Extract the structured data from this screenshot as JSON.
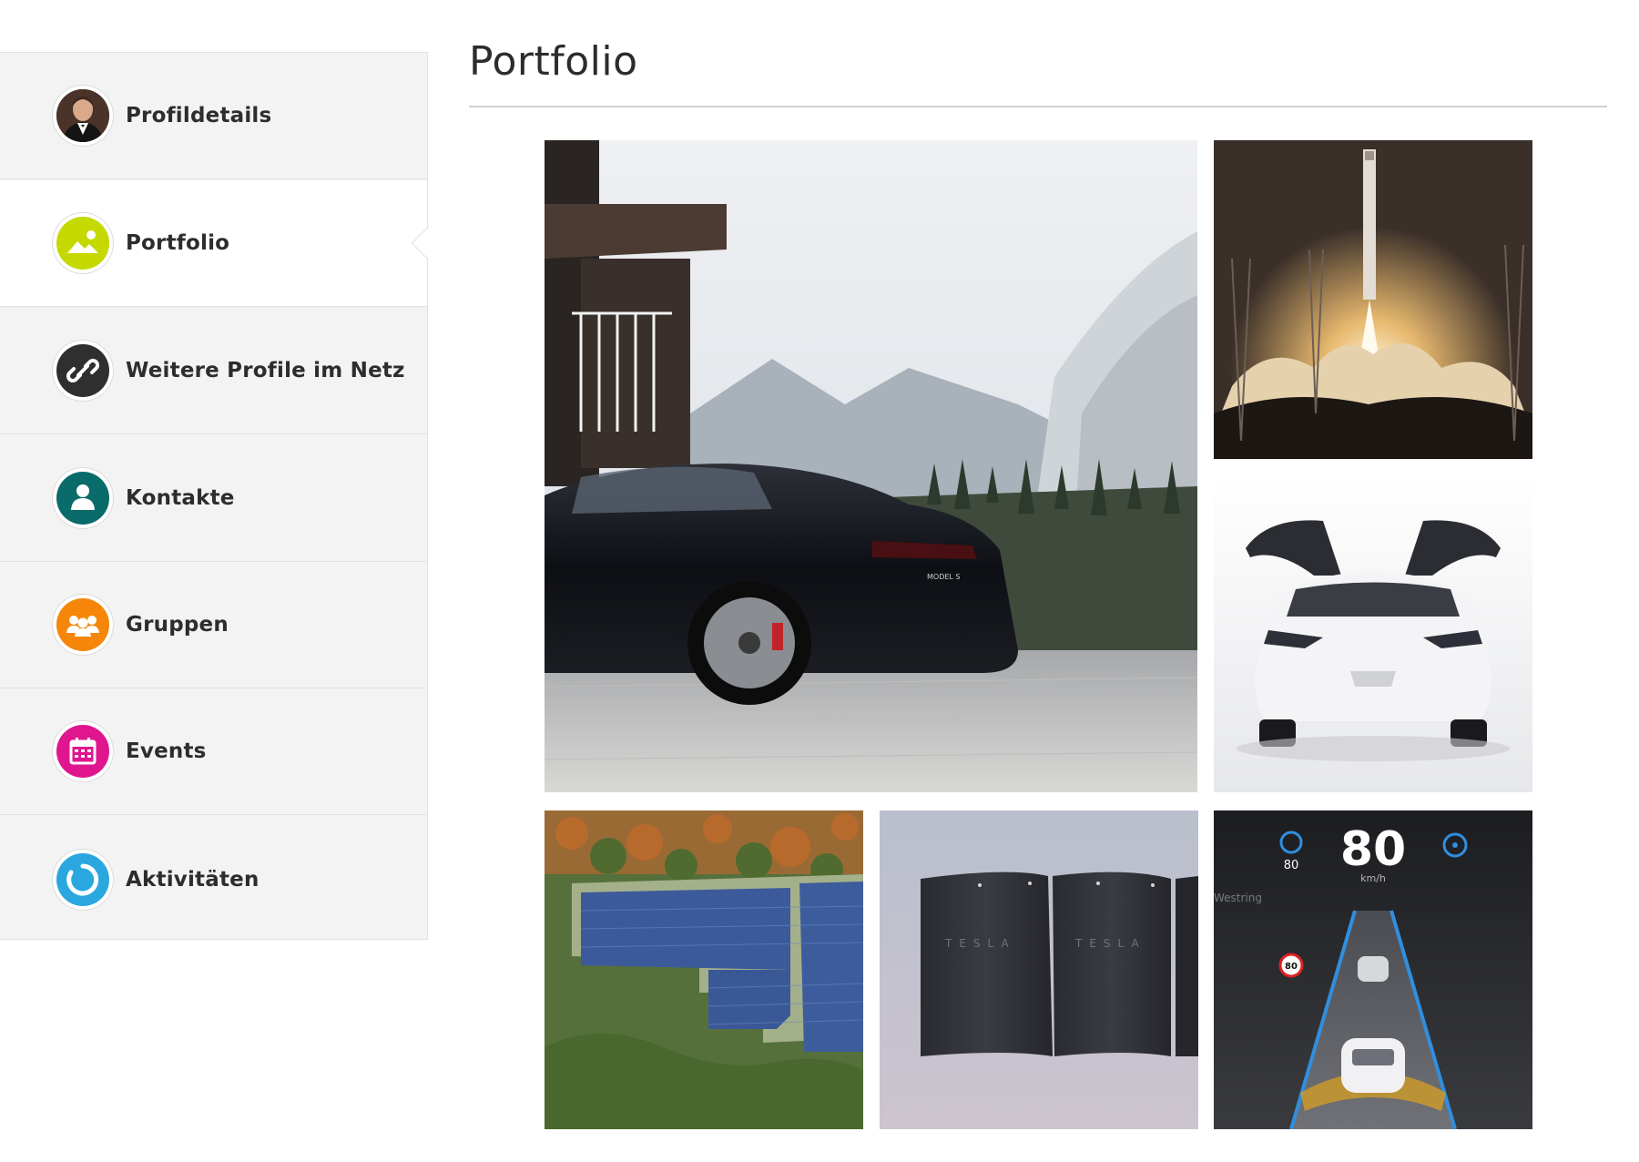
{
  "sidebar": {
    "items": [
      {
        "label": "Profildetails",
        "icon": "avatar-photo",
        "active": false
      },
      {
        "label": "Portfolio",
        "icon": "image-icon",
        "color": "#c5d900",
        "active": true
      },
      {
        "label": "Weitere Profile im Netz",
        "icon": "link-icon",
        "color": "#2f2f2f",
        "active": false
      },
      {
        "label": "Kontakte",
        "icon": "person-icon",
        "color": "#0a6b6b",
        "active": false
      },
      {
        "label": "Gruppen",
        "icon": "group-icon",
        "color": "#f5860a",
        "active": false
      },
      {
        "label": "Events",
        "icon": "calendar-icon",
        "color": "#e0168e",
        "active": false
      },
      {
        "label": "Aktivitäten",
        "icon": "activity-ring-icon",
        "color": "#2ba7e0",
        "active": false
      }
    ]
  },
  "main": {
    "title": "Portfolio"
  },
  "portfolio": {
    "tiles": [
      {
        "subject": "black sedan parked in front of mountain house",
        "badge": "MODEL S"
      },
      {
        "subject": "rocket launch"
      },
      {
        "subject": "white SUV with falcon-wing doors open"
      },
      {
        "subject": "aerial view of solar farm in forest"
      },
      {
        "subject": "wall-mounted home batteries",
        "labels": [
          "TESLA",
          "TESLA"
        ]
      },
      {
        "subject": "car dashboard display",
        "speed": "80",
        "speed_unit": "km/h",
        "set_speed": "80",
        "speed_limit": "80",
        "street": "Westring"
      }
    ]
  }
}
